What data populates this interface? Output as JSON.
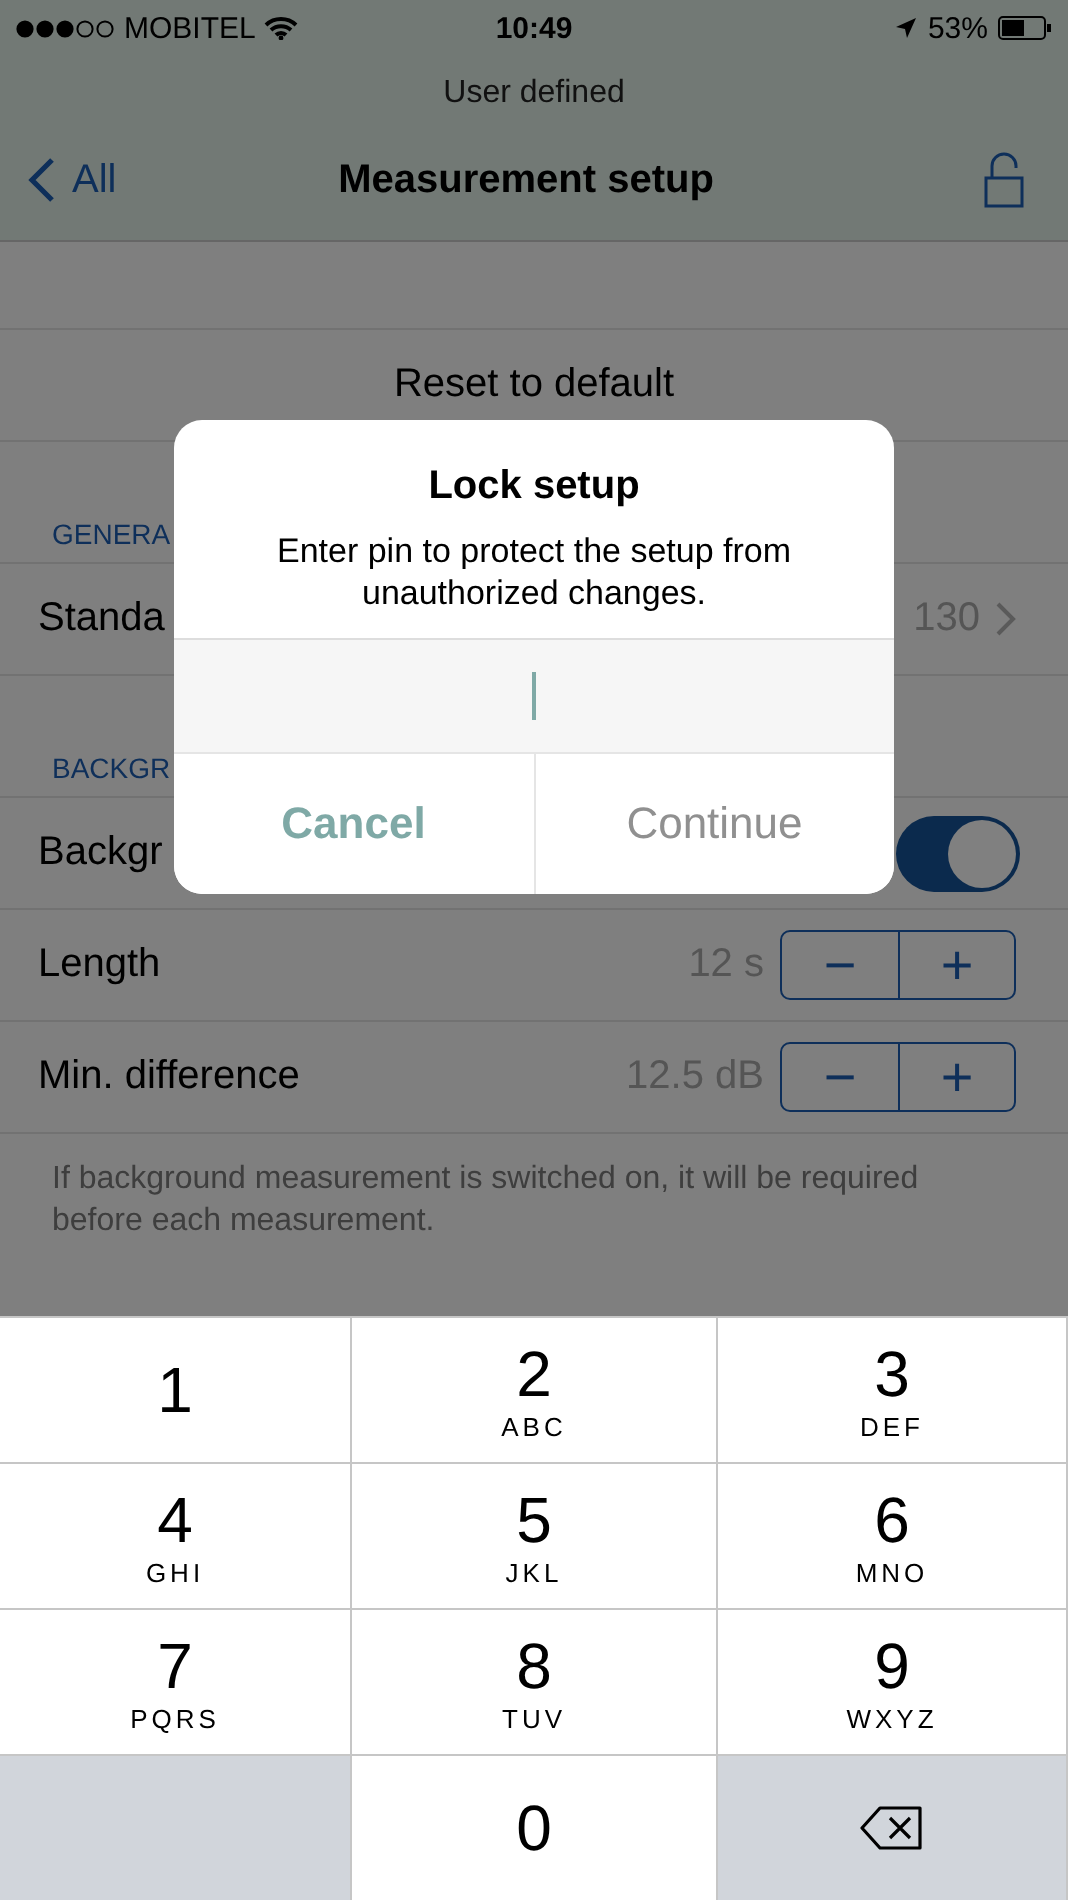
{
  "status_bar": {
    "carrier": "MOBITEL",
    "time": "10:49",
    "battery": "53%"
  },
  "header": {
    "subtitle": "User defined",
    "back": "All",
    "title": "Measurement setup"
  },
  "actions": [
    {
      "label": "Reset to default"
    }
  ],
  "sections": [
    {
      "header": "GENERA",
      "rows": [
        {
          "kind": "link",
          "label": "Standa",
          "value": "130"
        }
      ]
    },
    {
      "header": "BACKGR",
      "rows": [
        {
          "kind": "toggle",
          "label": "Backgr",
          "on": true
        },
        {
          "kind": "stepper",
          "label": "Length",
          "value": "12 s",
          "minus": "−",
          "plus": "+"
        },
        {
          "kind": "stepper",
          "label": "Min. difference",
          "value": "12.5 dB",
          "minus": "−",
          "plus": "+"
        }
      ],
      "footer": "If background measurement is switched on, it will be required before each measurement."
    }
  ],
  "dialog": {
    "title": "Lock setup",
    "message": "Enter pin to protect the setup from unauthorized changes.",
    "buttons": [
      {
        "label": "Cancel",
        "kind": "cancel",
        "disabled": false
      },
      {
        "label": "Continue",
        "kind": "confirm",
        "disabled": true
      }
    ]
  },
  "keyboard": [
    {
      "kind": "digit",
      "digit": "1"
    },
    {
      "kind": "digit",
      "digit": "2",
      "letters": "ABC"
    },
    {
      "kind": "digit",
      "digit": "3",
      "letters": "DEF"
    },
    {
      "kind": "digit",
      "digit": "4",
      "letters": "GHI"
    },
    {
      "kind": "digit",
      "digit": "5",
      "letters": "JKL"
    },
    {
      "kind": "digit",
      "digit": "6",
      "letters": "MNO"
    },
    {
      "kind": "digit",
      "digit": "7",
      "letters": "PQRS"
    },
    {
      "kind": "digit",
      "digit": "8",
      "letters": "TUV"
    },
    {
      "kind": "digit",
      "digit": "9",
      "letters": "WXYZ"
    },
    {
      "kind": "blank"
    },
    {
      "kind": "digit",
      "digit": "0"
    },
    {
      "kind": "delete"
    }
  ]
}
